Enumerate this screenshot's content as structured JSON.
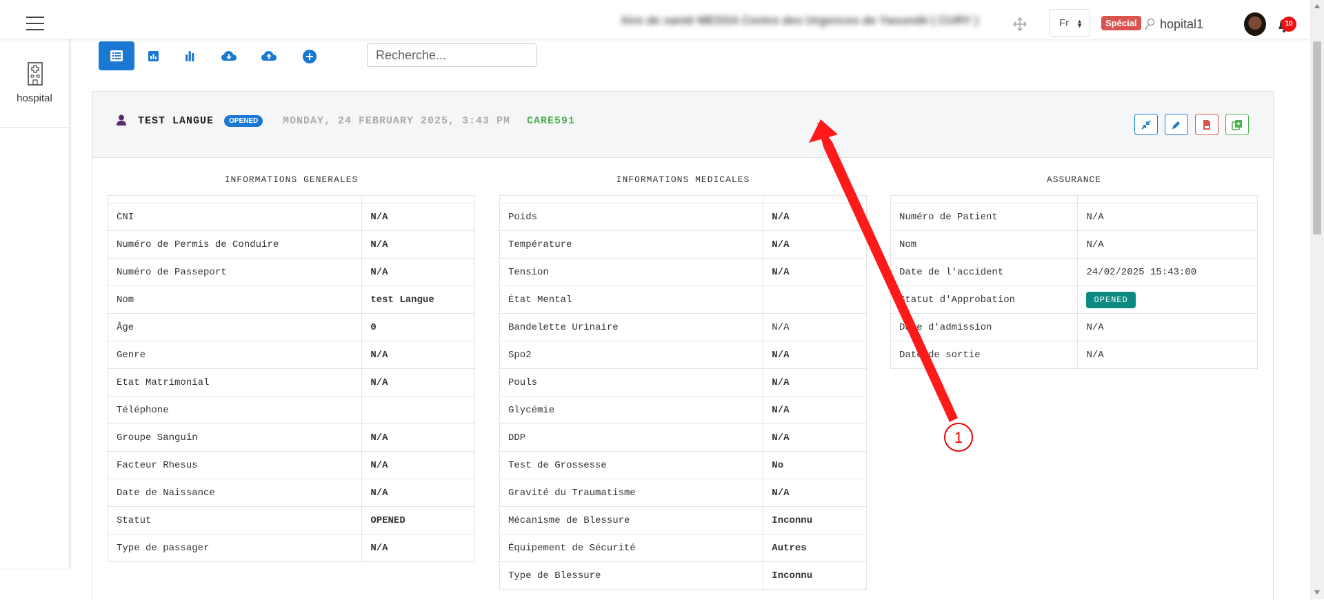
{
  "header": {
    "facility_name": "Aire de santé MESSA Centre des Urgences de Yaoundé ( CURY )",
    "language": "Fr",
    "special_badge": "Spécial",
    "username": "hopital1",
    "notification_count": "10"
  },
  "sidebar": {
    "items": [
      {
        "label": "hospital",
        "icon": "hospital-icon"
      }
    ]
  },
  "toolbar": {
    "buttons": [
      "list-view-icon",
      "report-icon",
      "bar-chart-icon",
      "download-cloud-icon",
      "upload-cloud-icon",
      "add-icon"
    ],
    "search_placeholder": "Recherche..."
  },
  "record": {
    "patient_name": "TEST LANGUE",
    "status": "OPENED",
    "datetime": "MONDAY, 24 FEBRUARY 2025, 3:43 PM",
    "code": "CARE591",
    "actions": [
      "collapse-icon",
      "edit-icon",
      "pdf-icon",
      "copy-icon"
    ]
  },
  "general": {
    "title": "INFORMATIONS GENERALES",
    "rows": [
      {
        "label": "CNI",
        "value": "N/A"
      },
      {
        "label": "Numéro de Permis de Conduire",
        "value": "N/A"
      },
      {
        "label": "Numéro de Passeport",
        "value": "N/A"
      },
      {
        "label": "Nom",
        "value": "test Langue"
      },
      {
        "label": "Âge",
        "value": "0"
      },
      {
        "label": "Genre",
        "value": "N/A"
      },
      {
        "label": "Etat Matrimonial",
        "value": "N/A"
      },
      {
        "label": "Téléphone",
        "value": ""
      },
      {
        "label": "Groupe Sanguin",
        "value": "N/A"
      },
      {
        "label": "Facteur Rhesus",
        "value": "N/A"
      },
      {
        "label": "Date de Naissance",
        "value": "N/A"
      },
      {
        "label": "Statut",
        "value": "OPENED"
      },
      {
        "label": "Type de passager",
        "value": "N/A"
      }
    ]
  },
  "medical": {
    "title": "INFORMATIONS MEDICALES",
    "rows": [
      {
        "label": "Poids",
        "value": "N/A"
      },
      {
        "label": "Température",
        "value": "N/A"
      },
      {
        "label": "Tension",
        "value": "N/A"
      },
      {
        "label": "État Mental",
        "value": ""
      },
      {
        "label": "Bandelette Urinaire",
        "value": "N/A"
      },
      {
        "label": "Spo2",
        "value": "N/A"
      },
      {
        "label": "Pouls",
        "value": "N/A"
      },
      {
        "label": "Glycémie",
        "value": "N/A"
      },
      {
        "label": "DDP",
        "value": "N/A"
      },
      {
        "label": "Test de Grossesse",
        "value": "No"
      },
      {
        "label": "Gravité du Traumatisme",
        "value": "N/A"
      },
      {
        "label": "Mécanisme de Blessure",
        "value": "Inconnu"
      },
      {
        "label": "Équipement de Sécurité",
        "value": "Autres"
      },
      {
        "label": "Type de Blessure",
        "value": "Inconnu"
      }
    ]
  },
  "insurance": {
    "title": "ASSURANCE",
    "rows": [
      {
        "label": "Numéro de Patient",
        "value": "N/A"
      },
      {
        "label": "Nom",
        "value": "N/A"
      },
      {
        "label": "Date de l'accident",
        "value": "24/02/2025 15:43:00"
      },
      {
        "label": "Statut d'Approbation",
        "value": "OPENED"
      },
      {
        "label": "Date d'admission",
        "value": "N/A"
      },
      {
        "label": "Date de sortie",
        "value": "N/A"
      }
    ]
  },
  "annotation": {
    "marker": "1",
    "color": "#ff0000"
  },
  "colors": {
    "primary": "#1a78d2",
    "success": "#4caf50",
    "danger": "#d9534f",
    "teal": "#0e8a84"
  }
}
